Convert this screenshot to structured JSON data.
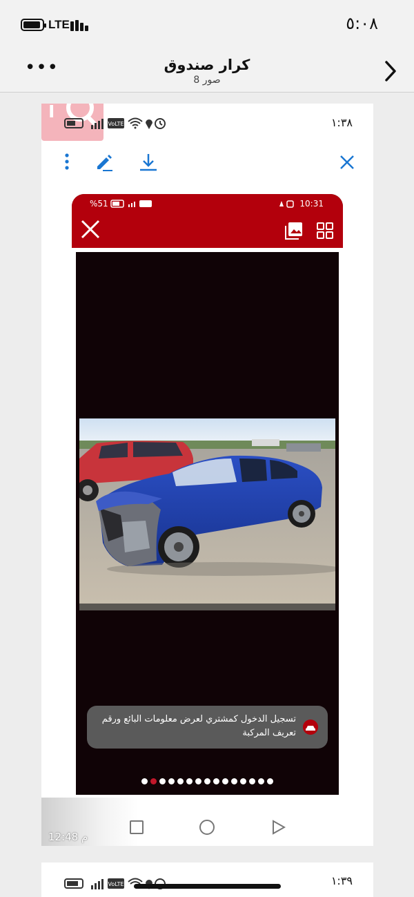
{
  "ios_status": {
    "network": "LTE",
    "time": "٥:٠٨"
  },
  "nav": {
    "title": "كرار صندوق",
    "subtitle": "8 صور",
    "more_icon": "ellipsis-icon",
    "back_icon": "chevron-right-icon"
  },
  "card": {
    "status_time": "١:٣٨",
    "volte": "VoLTE",
    "watermark_text": "iQ",
    "toolbar_icons": [
      "more-vertical-icon",
      "edit-pencil-icon",
      "download-icon",
      "close-icon"
    ],
    "phone": {
      "status_left": "%51",
      "status_right": "10:31",
      "header_icons": [
        "close-icon",
        "gallery-icon",
        "grid-icon"
      ],
      "login_banner": "تسجيل الدخول كمشتري لعرض معلومات البائع ورقم تعريف المركبة",
      "dots_count": 15,
      "active_dot": 1
    },
    "bottom_time": "12:48 م"
  },
  "card2": {
    "status_time": "١:٣٩",
    "volte": "VoLTE"
  },
  "colors": {
    "accent_blue": "#1976d2",
    "app_red": "#b3000c",
    "active_dot": "#c0172a"
  }
}
